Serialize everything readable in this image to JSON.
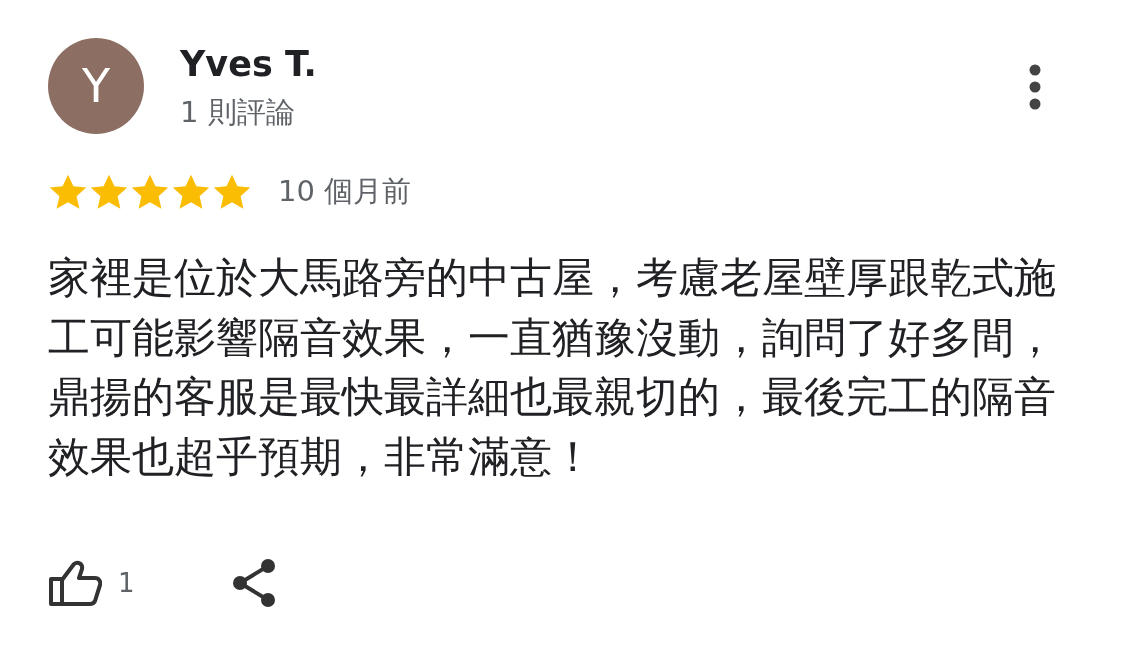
{
  "reviewer": {
    "initial": "Y",
    "name": "Yves T.",
    "review_count": "1 則評論"
  },
  "rating": {
    "stars": 5,
    "time": "10 個月前"
  },
  "text": "家裡是位於大馬路旁的中古屋，考慮老屋壁厚跟乾式施工可能影響隔音效果，一直猶豫沒動，詢問了好多間，鼎揚的客服是最快最詳細也最親切的，最後完工的隔音效果也超乎預期，非常滿意！",
  "actions": {
    "likes": "1"
  }
}
